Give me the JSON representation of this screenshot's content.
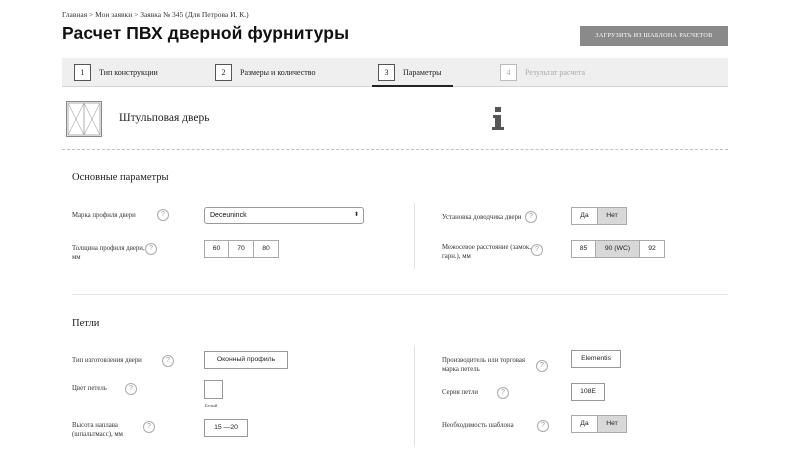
{
  "header": {
    "breadcrumb": "Главная > Мои заявки > Заявка № 345 (Для Петрова И. К.)",
    "title": "Расчет ПВХ дверной фурнитуры",
    "load_button": "ЗАГРУЗИТЬ ИЗ ШАБЛОНА РАСЧЕТОВ"
  },
  "steps": [
    {
      "num": "1",
      "label": "Тип конструкции"
    },
    {
      "num": "2",
      "label": "Размеры и количество"
    },
    {
      "num": "3",
      "label": "Параметры"
    },
    {
      "num": "4",
      "label": "Результат расчета"
    }
  ],
  "construction": {
    "label": "Штульповая дверь"
  },
  "icons": {
    "door": "door-thumbnail-icon",
    "info": "info-icon",
    "help": "question-icon"
  },
  "help_glyph": "?",
  "basic": {
    "title": "Основные параметры",
    "profile_brand": {
      "label": "Марка профиля двери",
      "value": "Deceuninck",
      "arrow": "⬍"
    },
    "profile_thickness": {
      "label": "Толщина профиля двери, мм",
      "options": [
        "60",
        "70",
        "80"
      ]
    },
    "closer": {
      "label": "Установка доводчика двери",
      "options": [
        "Да",
        "Нет"
      ],
      "selected": "Нет"
    },
    "axis_distance": {
      "label": "Межосевое расстояние (замок, гарн.), мм",
      "options": [
        "85",
        "90 (WC)",
        "92"
      ],
      "selected": "90 (WC)"
    }
  },
  "hinges": {
    "title": "Петли",
    "door_type": {
      "label": "Тип изготовления двери",
      "value": "Оконный профиль"
    },
    "hinge_color": {
      "label": "Цвет петель",
      "caption": "Белый"
    },
    "overlap_height": {
      "label": "Высота наплава (шпальтмасс), мм",
      "value": "15 —20"
    },
    "manufacturer": {
      "label": "Производитель или торговая марка петель",
      "value": "Elementis"
    },
    "series": {
      "label": "Серия петли",
      "value": "108E"
    },
    "template_needed": {
      "label": "Необходимость шаблона",
      "options": [
        "Да",
        "Нет"
      ],
      "selected": "Нет"
    }
  }
}
